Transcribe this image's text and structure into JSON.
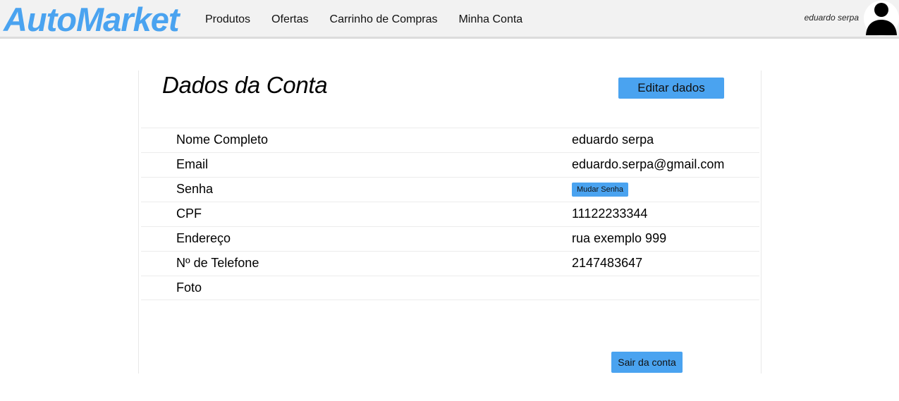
{
  "header": {
    "logo": "AutoMarket",
    "nav": [
      "Produtos",
      "Ofertas",
      "Carrinho de Compras",
      "Minha Conta"
    ],
    "user_name": "eduardo serpa",
    "avatar_icon": "user-silhouette-icon"
  },
  "account": {
    "title": "Dados da Conta",
    "edit_label": "Editar dados",
    "rows": [
      {
        "label": "Nome Completo",
        "value": "eduardo serpa"
      },
      {
        "label": "Email",
        "value": "eduardo.serpa@gmail.com"
      },
      {
        "label": "Senha",
        "button": "Mudar Senha"
      },
      {
        "label": "CPF",
        "value": "11122233344"
      },
      {
        "label": "Endereço",
        "value": "rua exemplo 999"
      },
      {
        "label": "Nº de Telefone",
        "value": "2147483647"
      },
      {
        "label": "Foto",
        "value": ""
      }
    ],
    "logout_label": "Sair da conta"
  },
  "colors": {
    "accent": "#4aa3f0",
    "header_bg": "#f2f2f2"
  }
}
